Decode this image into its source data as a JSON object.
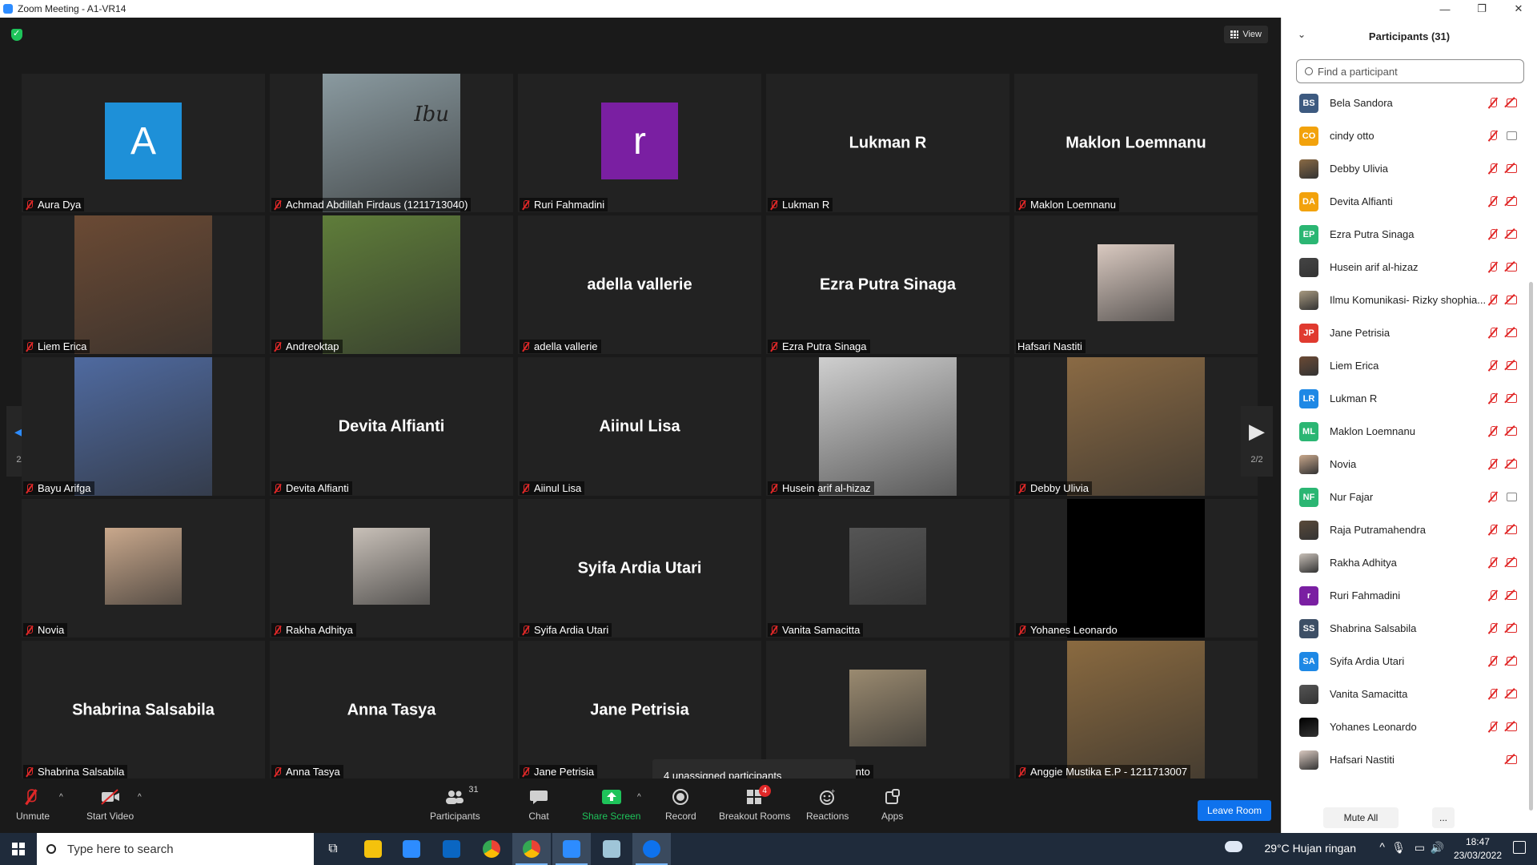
{
  "window": {
    "title": "Zoom Meeting - A1-VR14"
  },
  "meeting": {
    "view_label": "View",
    "page_indicator": "2/2",
    "toast": "4 unassigned participants",
    "tiles": [
      {
        "label": "Aura Dya",
        "kind": "letter",
        "letter": "A",
        "color": "#1e90d8"
      },
      {
        "label": "Achmad Abdillah Firdaus (1211713040)",
        "kind": "photo-full",
        "photo": "person-icon",
        "overlay": "Ibu",
        "color": "#8a9aa0"
      },
      {
        "label": "Ruri Fahmadini",
        "kind": "letter",
        "letter": "r",
        "color": "#7a1fa2"
      },
      {
        "label": "Lukman R",
        "kind": "name",
        "name": "Lukman R"
      },
      {
        "label": "Maklon Loemnanu",
        "kind": "name",
        "name": "Maklon Loemnanu"
      },
      {
        "label": "Liem Erica",
        "kind": "photo-full",
        "photo": "person-icon",
        "color": "#6b4a34"
      },
      {
        "label": "Andreoktap",
        "kind": "photo-full",
        "photo": "landscape-icon",
        "color": "#5f7d3a"
      },
      {
        "label": "adella vallerie",
        "kind": "name",
        "name": "adella vallerie"
      },
      {
        "label": "Ezra Putra Sinaga",
        "kind": "name",
        "name": "Ezra Putra Sinaga"
      },
      {
        "label": "Hafsari Nastiti",
        "kind": "photo-small",
        "photo": "person-icon",
        "color": "#d9c9c0",
        "muted": false
      },
      {
        "label": "Bayu Arifga",
        "kind": "photo-full",
        "photo": "cat-icon",
        "color": "#4f6aa0"
      },
      {
        "label": "Devita Alfianti",
        "kind": "name",
        "name": "Devita Alfianti"
      },
      {
        "label": "Aiinul Lisa",
        "kind": "name",
        "name": "Aiinul Lisa"
      },
      {
        "label": "Husein arif al-hizaz",
        "kind": "photo-full",
        "photo": "anime-icon",
        "color": "#cfcfcf"
      },
      {
        "label": "Debby Ulivia",
        "kind": "photo-full",
        "photo": "person-icon",
        "color": "#8a6a44"
      },
      {
        "label": "Novia",
        "kind": "photo-small",
        "photo": "person-icon",
        "color": "#c9a88c"
      },
      {
        "label": "Rakha Adhitya",
        "kind": "photo-small",
        "photo": "person-icon",
        "color": "#c8c0b8"
      },
      {
        "label": "Syifa Ardia Utari",
        "kind": "name",
        "name": "Syifa Ardia Utari"
      },
      {
        "label": "Vanita Samacitta",
        "kind": "photo-small",
        "photo": "person-icon",
        "color": "#555555"
      },
      {
        "label": "Yohanes Leonardo",
        "kind": "photo-full",
        "photo": "blank-icon",
        "color": "#000000"
      },
      {
        "label": "Shabrina Salsabila",
        "kind": "name",
        "name": "Shabrina Salsabila"
      },
      {
        "label": "Anna Tasya",
        "kind": "name",
        "name": "Anna Tasya"
      },
      {
        "label": "Jane Petrisia",
        "kind": "name",
        "name": "Jane Petrisia"
      },
      {
        "label": "i- Rizky shophianto",
        "kind": "photo-small",
        "photo": "person-icon",
        "color": "#9a8a70"
      },
      {
        "label": "Anggie Mustika E.P - 1211713007",
        "kind": "photo-full",
        "photo": "group-photo-icon",
        "color": "#8a6a40"
      }
    ]
  },
  "toolbar": {
    "unmute": "Unmute",
    "start_video": "Start Video",
    "participants": "Participants",
    "participants_count": "31",
    "chat": "Chat",
    "share_screen": "Share Screen",
    "record": "Record",
    "breakout_rooms": "Breakout Rooms",
    "breakout_badge": "4",
    "reactions": "Reactions",
    "apps": "Apps",
    "leave_room": "Leave Room"
  },
  "panel": {
    "title": "Participants (31)",
    "search_placeholder": "Find a participant",
    "mute_all": "Mute All",
    "more": "...",
    "participants": [
      {
        "name": "Bela Sandora",
        "initials": "BS",
        "color": "#3d5a80",
        "mic": "muted",
        "cam": "off"
      },
      {
        "name": "cindy otto",
        "initials": "CO",
        "color": "#f2a20c",
        "mic": "muted",
        "cam": "on"
      },
      {
        "name": "Debby Ulivia",
        "initials": "",
        "color": "#8a6a44",
        "mic": "muted",
        "cam": "off"
      },
      {
        "name": "Devita Alfianti",
        "initials": "DA",
        "color": "#f2a20c",
        "mic": "muted",
        "cam": "off"
      },
      {
        "name": "Ezra Putra Sinaga",
        "initials": "EP",
        "color": "#2bb673",
        "mic": "muted",
        "cam": "off"
      },
      {
        "name": "Husein arif al-hizaz",
        "initials": "",
        "color": "#444444",
        "mic": "muted",
        "cam": "off"
      },
      {
        "name": "Ilmu Komunikasi- Rizky shophia...",
        "initials": "",
        "color": "#a89a80",
        "mic": "muted",
        "cam": "off"
      },
      {
        "name": "Jane Petrisia",
        "initials": "JP",
        "color": "#e03a2f",
        "mic": "muted",
        "cam": "off"
      },
      {
        "name": "Liem Erica",
        "initials": "",
        "color": "#6b4a34",
        "mic": "muted",
        "cam": "off"
      },
      {
        "name": "Lukman R",
        "initials": "LR",
        "color": "#1e88e5",
        "mic": "muted",
        "cam": "off"
      },
      {
        "name": "Maklon Loemnanu",
        "initials": "ML",
        "color": "#2bb673",
        "mic": "muted",
        "cam": "off"
      },
      {
        "name": "Novia",
        "initials": "",
        "color": "#c9a88c",
        "mic": "muted",
        "cam": "off"
      },
      {
        "name": "Nur Fajar",
        "initials": "NF",
        "color": "#2bb673",
        "mic": "muted",
        "cam": "on"
      },
      {
        "name": "Raja Putramahendra",
        "initials": "",
        "color": "#5a4a3a",
        "mic": "muted",
        "cam": "off"
      },
      {
        "name": "Rakha Adhitya",
        "initials": "",
        "color": "#c8c0b8",
        "mic": "muted",
        "cam": "off"
      },
      {
        "name": "Ruri Fahmadini",
        "initials": "r",
        "color": "#7a1fa2",
        "mic": "muted",
        "cam": "off"
      },
      {
        "name": "Shabrina Salsabila",
        "initials": "SS",
        "color": "#3d4f66",
        "mic": "muted",
        "cam": "off"
      },
      {
        "name": "Syifa Ardia Utari",
        "initials": "SA",
        "color": "#1e88e5",
        "mic": "muted",
        "cam": "off"
      },
      {
        "name": "Vanita Samacitta",
        "initials": "",
        "color": "#555555",
        "mic": "muted",
        "cam": "off"
      },
      {
        "name": "Yohanes Leonardo",
        "initials": "",
        "color": "#000000",
        "mic": "muted",
        "cam": "off"
      },
      {
        "name": "Hafsari Nastiti",
        "initials": "",
        "color": "#d9c9c0",
        "mic": "none",
        "cam": "off"
      }
    ]
  },
  "taskbar": {
    "search_placeholder": "Type here to search",
    "weather": "29°C  Hujan ringan",
    "time": "18:47",
    "date": "23/03/2022"
  },
  "colors": {
    "accent_blue": "#0e72ed",
    "muted_red": "#e02828",
    "share_green": "#1ec35a"
  }
}
